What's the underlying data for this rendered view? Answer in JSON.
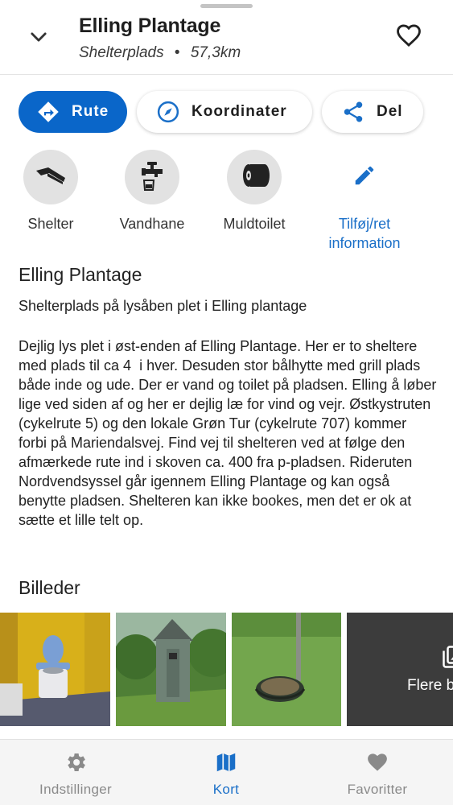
{
  "header": {
    "title": "Elling Plantage",
    "category": "Shelterplads",
    "separator": "•",
    "distance": "57,3km"
  },
  "actions": {
    "route_label": "Rute",
    "coordinates_label": "Koordinater",
    "share_label": "Del"
  },
  "facilities": [
    {
      "label": "Shelter",
      "icon": "shelter-icon"
    },
    {
      "label": "Vandhane",
      "icon": "water-tap-icon"
    },
    {
      "label": "Muldtoilet",
      "icon": "toilet-paper-icon"
    }
  ],
  "edit_info": {
    "line1": "Tilføj/ret",
    "line2": "information",
    "icon": "edit-pencil-icon"
  },
  "description": {
    "heading": "Elling Plantage",
    "short": "Shelterplads på lysåben plet i Elling plantage",
    "long": "Dejlig lys plet i øst-enden af Elling Plantage. Her er to sheltere med plads til ca 4  i hver. Desuden stor bålhytte med grill plads både inde og ude. Der er vand og toilet på pladsen. Elling å løber lige ved siden af og her er dejlig læ for vind og vejr. Østkystruten (cykelrute 5) og den lokale Grøn Tur (cykelrute 707) kommer forbi på Mariendalsvej. Find vej til shelteren ved at følge den afmærkede rute ind i skoven ca. 400 fra p-pladsen. Rideruten Nordvendsyssel går igennem Elling Plantage og kan også benytte pladsen. Shelteren kan ikke bookes, men det er ok at sætte et lille telt op."
  },
  "pictures": {
    "title": "Billeder",
    "more_label": "Flere billeder"
  },
  "bottom_nav": {
    "settings": "Indstillinger",
    "map": "Kort",
    "favorites": "Favoritter"
  },
  "colors": {
    "accent": "#0a66c9",
    "active_nav": "#1a6fc8",
    "inactive_nav": "#8a8a8a"
  }
}
